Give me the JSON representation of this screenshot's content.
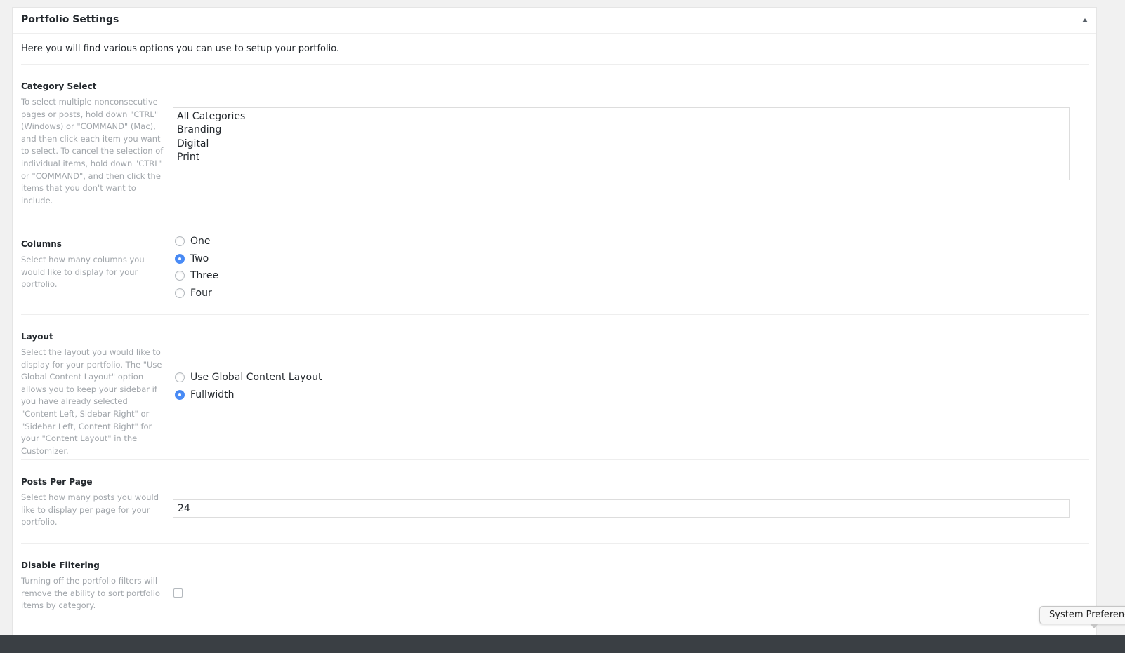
{
  "panel": {
    "title": "Portfolio Settings",
    "intro": "Here you will find various options you can use to setup your portfolio."
  },
  "category_select": {
    "label": "Category Select",
    "description": "To select multiple nonconsecutive pages or posts, hold down \"CTRL\" (Windows) or \"COMMAND\" (Mac), and then click each item you want to select. To cancel the selection of individual items, hold down \"CTRL\" or \"COMMAND\", and then click the items that you don't want to include.",
    "options": [
      "All Categories",
      "Branding",
      "Digital",
      "Print"
    ]
  },
  "columns": {
    "label": "Columns",
    "description": "Select how many columns you would like to display for your portfolio.",
    "options": [
      "One",
      "Two",
      "Three",
      "Four"
    ],
    "selected": "Two"
  },
  "layout": {
    "label": "Layout",
    "description": "Select the layout you would like to display for your portfolio. The \"Use Global Content Layout\" option allows you to keep your sidebar if you have already selected \"Content Left, Sidebar Right\" or \"Sidebar Left, Content Right\" for your \"Content Layout\" in the Customizer.",
    "options": [
      "Use Global Content Layout",
      "Fullwidth"
    ],
    "selected": "Fullwidth"
  },
  "posts_per_page": {
    "label": "Posts Per Page",
    "description": "Select how many posts you would like to display per page for your portfolio.",
    "value": "24"
  },
  "disable_filtering": {
    "label": "Disable Filtering",
    "description": "Turning off the portfolio filters will remove the ability to sort portfolio items by category.",
    "checked": false
  },
  "tooltip": {
    "text": "System Preferences"
  },
  "colors": {
    "accent": "#4a8cf7",
    "description_text": "#a0a5aa",
    "dock": "#3a3f44"
  }
}
